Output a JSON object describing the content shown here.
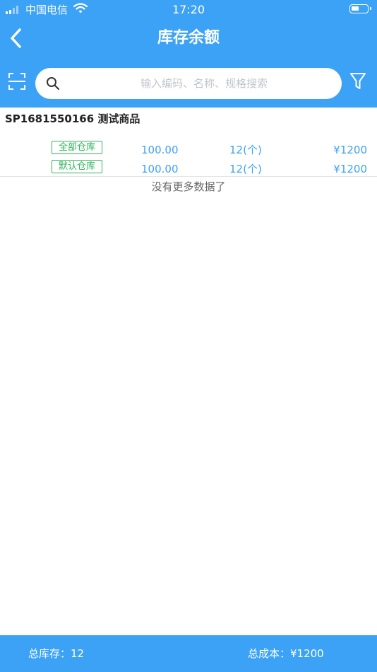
{
  "status_bar": {
    "carrier": "中国电信",
    "time": "17:20"
  },
  "header": {
    "title": "库存余额",
    "back_icon": "chevron-left-icon"
  },
  "search": {
    "placeholder": "输入编码、名称、规格搜索",
    "value": "",
    "scan_icon": "scan-icon",
    "search_icon": "magnifier-icon",
    "filter_icon": "funnel-icon"
  },
  "product": {
    "title": "SP1681550166 测试商品",
    "rows": [
      {
        "warehouse": "全部仓库",
        "price": "100.00",
        "qty": "12(个)",
        "amount": "¥1200"
      },
      {
        "warehouse": "默认仓库",
        "price": "100.00",
        "qty": "12(个)",
        "amount": "¥1200"
      }
    ]
  },
  "list_end_text": "没有更多数据了",
  "footer": {
    "total_stock": "总库存：12",
    "total_cost": "总成本：¥1200"
  },
  "colors": {
    "primary": "#3ca2f5",
    "tag_green": "#2fb45a",
    "background": "#ffffff"
  }
}
